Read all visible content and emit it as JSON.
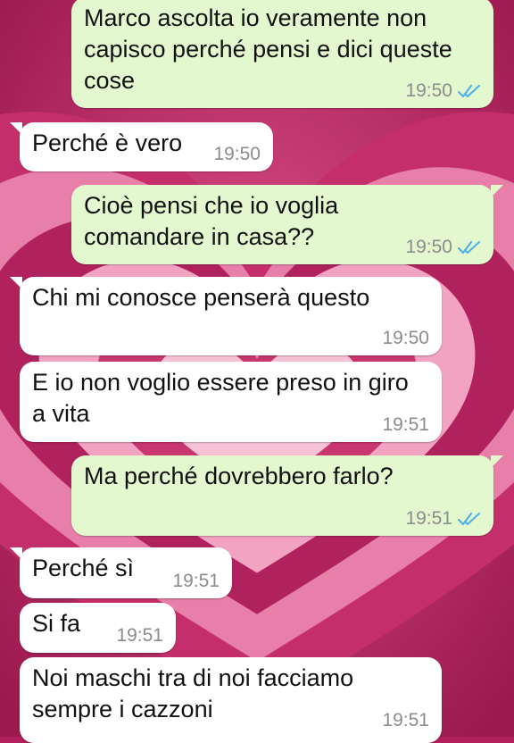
{
  "theme": {
    "sent_bubble": "#e4f8cf",
    "received_bubble": "#ffffff",
    "read_check_color": "#4fb3e8",
    "wallpaper": "pink-hearts"
  },
  "messages": [
    {
      "direction": "sent",
      "text": "Marco ascolta io veramente non\ncapisco perché pensi e dici queste\ncose",
      "time": "19:50",
      "status": "read"
    },
    {
      "direction": "received",
      "text": "Perché è vero",
      "time": "19:50"
    },
    {
      "direction": "sent",
      "text": "Cioè pensi che io voglia\ncomandare in casa??",
      "time": "19:50",
      "status": "read"
    },
    {
      "direction": "received",
      "text": "Chi mi conosce penserà questo",
      "time": "19:50"
    },
    {
      "direction": "received",
      "text": "E io non voglio essere preso in giro\na vita",
      "time": "19:51"
    },
    {
      "direction": "sent",
      "text": "Ma perché dovrebbero farlo?",
      "time": "19:51",
      "status": "read"
    },
    {
      "direction": "received",
      "text": "Perché sì",
      "time": "19:51"
    },
    {
      "direction": "received",
      "text": "Si fa",
      "time": "19:51"
    },
    {
      "direction": "received",
      "text": "Noi maschi tra di noi facciamo\nsempre i cazzoni",
      "time": "19:51"
    }
  ]
}
